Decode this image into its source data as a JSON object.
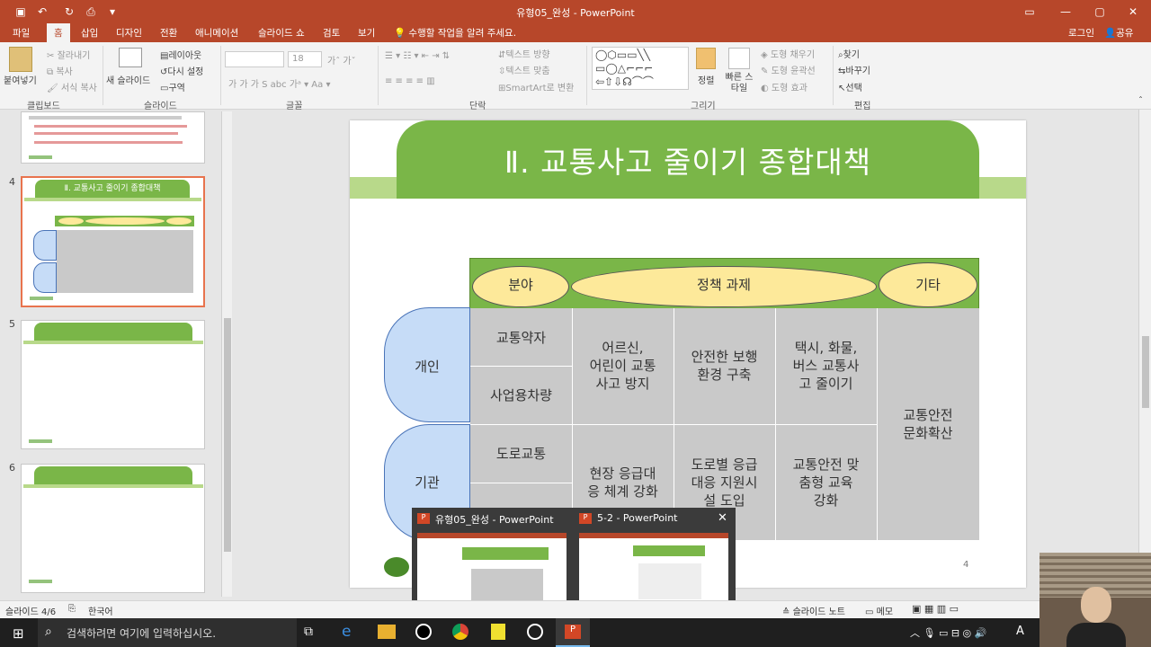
{
  "window": {
    "title": "유형05_완성 - PowerPoint",
    "signin": "로그인",
    "share": "공유"
  },
  "tabs": [
    "파일",
    "홈",
    "삽입",
    "디자인",
    "전환",
    "애니메이션",
    "슬라이드 쇼",
    "검토",
    "보기"
  ],
  "tell_me": "수행할 작업을 알려 주세요.",
  "ribbon": {
    "clipboard": {
      "paste": "붙여넣기",
      "cut": "잘라내기",
      "copy": "복사",
      "format_painter": "서식 복사",
      "label": "클립보드"
    },
    "slides": {
      "new_slide": "새 슬라이드",
      "layout": "레이아웃",
      "reset": "다시 설정",
      "section": "구역",
      "label": "슬라이드"
    },
    "font": {
      "size": "18",
      "label": "글꼴"
    },
    "paragraph": {
      "text_direction": "텍스트 방향",
      "align_text": "텍스트 맞춤",
      "smartart": "SmartArt로 변환",
      "label": "단락"
    },
    "drawing": {
      "arrange": "정렬",
      "quick_styles": "빠른 스타일",
      "shape_fill": "도형 채우기",
      "shape_outline": "도형 윤곽선",
      "shape_effects": "도형 효과",
      "label": "그리기"
    },
    "editing": {
      "find": "찾기",
      "replace": "바꾸기",
      "select": "선택",
      "label": "편집"
    }
  },
  "thumbnails": [
    {
      "number": "4",
      "title": "Ⅱ. 교통사고 줄이기 종합대책"
    },
    {
      "number": "5"
    },
    {
      "number": "6"
    }
  ],
  "slide": {
    "title": "Ⅱ. 교통사고 줄이기 종합대책",
    "header": {
      "field": "분야",
      "policy": "정책 과제",
      "other": "기타"
    },
    "rows": {
      "individual": "개인",
      "institution": "기관"
    },
    "cells": {
      "c1": "교통약자",
      "c2": "사업용차량",
      "c3": "도로교통",
      "c4": "어르신,\n어린이 교통\n사고 방지",
      "c5": "안전한 보행\n환경 구축",
      "c6": "택시, 화물,\n버스 교통사\n고 줄이기",
      "c7": "교통안전\n문화확산",
      "c8": "현장 응급대\n응 체계 강화",
      "c9": "도로별 응급\n대응 지원시\n설 도입",
      "c10": "교통안전 맞\n춤형 교육\n강화"
    },
    "page_number": "4"
  },
  "status": {
    "slide_info": "슬라이드 4/6",
    "language": "한국어",
    "notes": "슬라이드 노트",
    "comments": "메모"
  },
  "taskbar": {
    "search_placeholder": "검색하려면 여기에 입력하십시오.",
    "ime": "A"
  },
  "popup": {
    "item1": "유형05_완성 - PowerPoint",
    "item2": "5-2 - PowerPoint"
  },
  "colors": {
    "accent": "#b7472a",
    "green": "#7ab648",
    "yellow": "#fde99a",
    "blue": "#c6dcf7",
    "gray": "#c9c9c9"
  }
}
